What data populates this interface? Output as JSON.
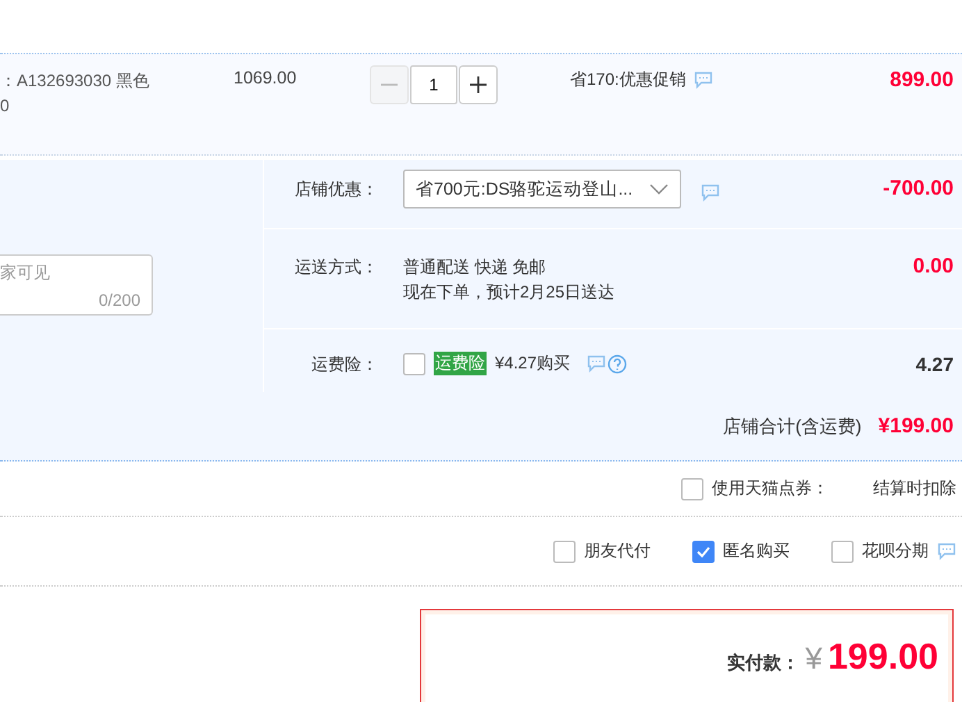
{
  "item": {
    "spec": "：A132693030 黑色",
    "spec_2": "0",
    "unit_price": "1069.00",
    "quantity": {
      "value": "1",
      "decrease_disabled": true
    },
    "promo": "省170:优惠促销",
    "subtotal": "899.00"
  },
  "shop": {
    "note_field": {
      "placeholder": "家可见",
      "counter": "0/200"
    },
    "rows": [
      {
        "kind": "select",
        "label": "店铺优惠：",
        "value": "省700元:DS骆驼运动登山...",
        "amount": "-700.00",
        "highlight": true
      },
      {
        "kind": "shipping",
        "label": "运送方式：",
        "lines": [
          "普通配送 快递 免邮",
          "现在下单，预计2月25日送达"
        ],
        "amount": "0.00",
        "highlight": true
      },
      {
        "kind": "insurance",
        "label": "运费险：",
        "checked": false,
        "tag": "运费险",
        "text": "¥4.27购买",
        "amount": "4.27",
        "highlight": false
      }
    ]
  },
  "total": {
    "label": "店铺合计(含运费)",
    "value": "¥199.00"
  },
  "coupon": {
    "checked": false,
    "label": "使用天猫点券：",
    "note": "结算时扣除"
  },
  "options": [
    {
      "label": "朋友代付",
      "checked": false,
      "info": false
    },
    {
      "label": "匿名购买",
      "checked": true,
      "info": false
    },
    {
      "label": "花呗分期",
      "checked": false,
      "info": true
    }
  ],
  "payment": {
    "label": "实付款：",
    "currency": "¥",
    "amount": "199.00"
  }
}
